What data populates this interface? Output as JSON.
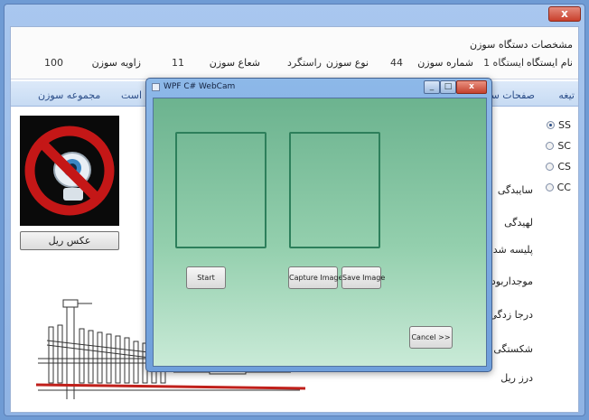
{
  "outer_window": {
    "close_label": "x",
    "device_info": {
      "title": "مشخصات دستگاه سوزن",
      "station_label": "نام ایستگاه",
      "station_value": "ایستگاه 1",
      "switch_number_label": "شماره سوزن",
      "switch_number_value": "44",
      "switch_type_label": "نوع سوزن",
      "switch_type_value": "راستگرد",
      "radius_label": "شعاع سوزن",
      "radius_value": "11",
      "angle_label": "زاویه سوزن",
      "angle_value": "100"
    },
    "tabs": [
      {
        "label": "تیغه"
      },
      {
        "label": "صفحات سر"
      },
      {
        "label": "است"
      },
      {
        "label": "مجموعه سوزن"
      }
    ],
    "photo_button_label": "عکس ریل",
    "radio_options": [
      {
        "label": "SS",
        "checked": true
      },
      {
        "label": "SC",
        "checked": false
      },
      {
        "label": "CS",
        "checked": false
      },
      {
        "label": "CC",
        "checked": false
      }
    ],
    "defect_labels": [
      "سایبدگی",
      "لهیدگی",
      "پلیسه شدن",
      "موجداربودن",
      "درجا زدگی",
      "شکستگی",
      "درز ریل"
    ]
  },
  "dialog": {
    "title": "WPF C# WebCam",
    "min_label": "_",
    "max_label": "□",
    "close_label": "x",
    "start_label": "Start",
    "capture_label": "Capture Image",
    "save_label": "Save Image",
    "cancel_label": "Cancel >>"
  },
  "colors": {
    "dialog_frame": "#6f9fdb",
    "dialog_gradient_top": "#6cb38f",
    "dialog_gradient_bottom": "#c9ead7",
    "preview_border": "#2d7f5b",
    "rail_red": "#c0201b",
    "no_symbol_red": "#c41717"
  },
  "icons": {
    "webcam_image": "no-webcam-icon"
  }
}
